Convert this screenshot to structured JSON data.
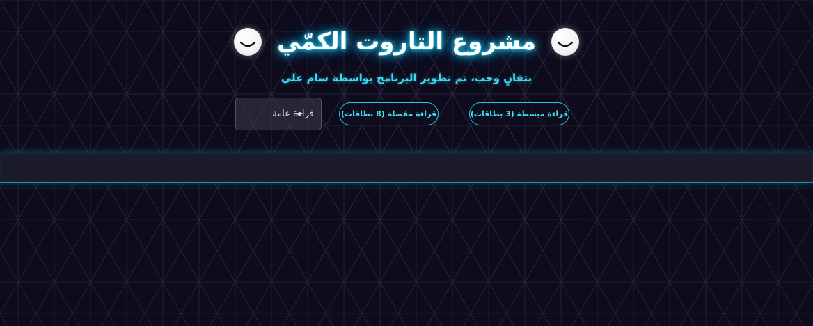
{
  "header": {
    "title": "مشروع التاروت الكمّي",
    "left_icon": "moon-face-icon",
    "right_icon": "moon-face-icon"
  },
  "subtitle": "بتفانٍ وحب، تم تطوير البرنامج بواسطة سام علي",
  "controls": {
    "reading_select": {
      "selected": "قراءة عامة",
      "icon": "chevron-down-icon"
    },
    "detailed_reading_button": "قراءة مفصلة (8 بطاقات)",
    "simple_reading_button": "قراءة مبسطة (3 بطاقات)"
  },
  "colors": {
    "background": "#0e0c1c",
    "accent": "#22c9e4",
    "title_glow": "#1fd3f0",
    "band": "#1a1a2a"
  }
}
